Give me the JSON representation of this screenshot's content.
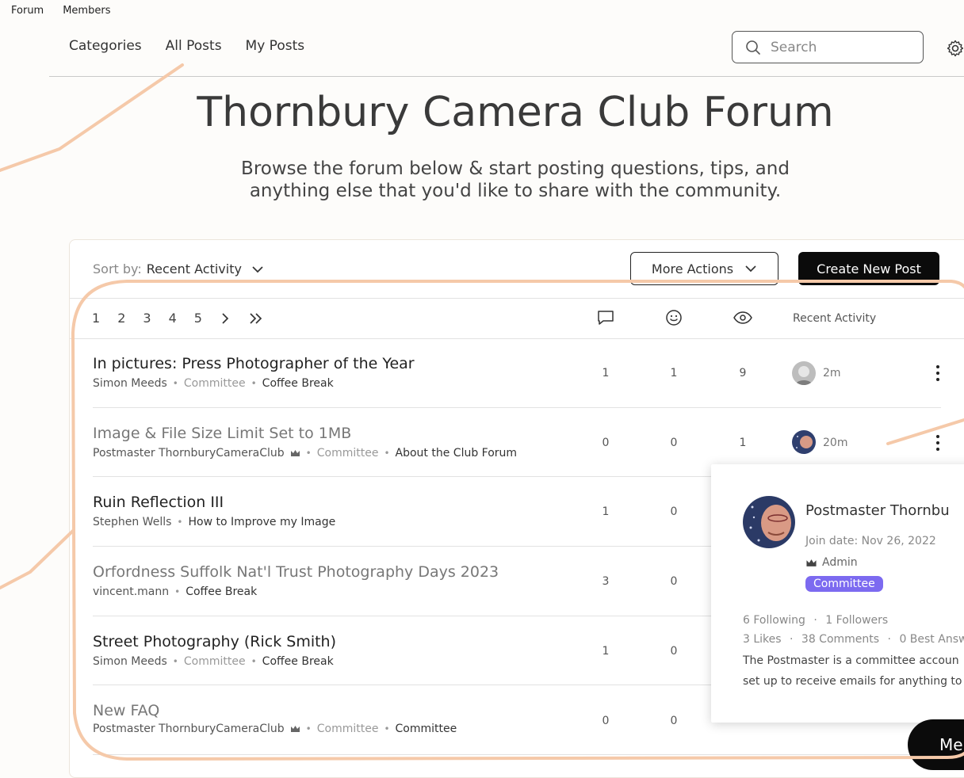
{
  "topnav": {
    "forum": "Forum",
    "members": "Members"
  },
  "subnav": {
    "categories": "Categories",
    "all_posts": "All Posts",
    "my_posts": "My Posts"
  },
  "search": {
    "placeholder": "Search"
  },
  "header": {
    "title": "Thornbury Camera Club Forum",
    "subtitle_line1": "Browse the forum below & start posting questions, tips, and",
    "subtitle_line2": "anything else that you'd like to share with the community."
  },
  "toolbar": {
    "sort_label": "Sort by:",
    "sort_value": "Recent Activity",
    "more_actions": "More Actions",
    "create_post": "Create New Post"
  },
  "pagination": {
    "pages": [
      "1",
      "2",
      "3",
      "4",
      "5"
    ]
  },
  "columns": {
    "recent_activity": "Recent Activity"
  },
  "posts": [
    {
      "title": "In pictures: Press Photographer of the Year",
      "author": "Simon Meeds",
      "role": "Committee",
      "category": "Coffee Break",
      "comments": "1",
      "likes": "1",
      "views": "9",
      "time": "2m",
      "muted": false
    },
    {
      "title": "Image & File Size Limit Set to 1MB",
      "author": "Postmaster ThornburyCameraClub",
      "role": "Committee",
      "category": "About the Club Forum",
      "comments": "0",
      "likes": "0",
      "views": "1",
      "time": "20m",
      "muted": true
    },
    {
      "title": "Ruin Reflection III",
      "author": "Stephen Wells",
      "role": "",
      "category": "How to Improve my Image",
      "comments": "1",
      "likes": "0",
      "views": "",
      "time": "",
      "muted": false
    },
    {
      "title": "Orfordness Suffolk Nat'l Trust Photography Days 2023",
      "author": "vincent.mann",
      "role": "",
      "category": "Coffee Break",
      "comments": "3",
      "likes": "0",
      "views": "",
      "time": "",
      "muted": true
    },
    {
      "title": "Street Photography (Rick Smith)",
      "author": "Simon Meeds",
      "role": "Committee",
      "category": "Coffee Break",
      "comments": "1",
      "likes": "0",
      "views": "",
      "time": "",
      "muted": false
    },
    {
      "title": "New FAQ",
      "author": "Postmaster ThornburyCameraClub",
      "role": "Committee",
      "category": "Committee",
      "comments": "0",
      "likes": "0",
      "views": "",
      "time": "",
      "muted": true
    }
  ],
  "profile_card": {
    "name": "Postmaster Thornbu",
    "join_date": "Join date: Nov 26, 2022",
    "admin_label": "Admin",
    "badge": "Committee",
    "following": "6 Following",
    "followers": "1 Followers",
    "likes": "3 Likes",
    "comments": "38 Comments",
    "best_answers": "0 Best Answ",
    "bio_line1": "The Postmaster is a committee accoun",
    "bio_line2": "set up to receive emails for anything to"
  },
  "chat_button": {
    "label": "Me"
  },
  "colors": {
    "accent": "#f5c9a9",
    "badge": "#7c6af0",
    "primary_button": "#0b0b0b"
  }
}
